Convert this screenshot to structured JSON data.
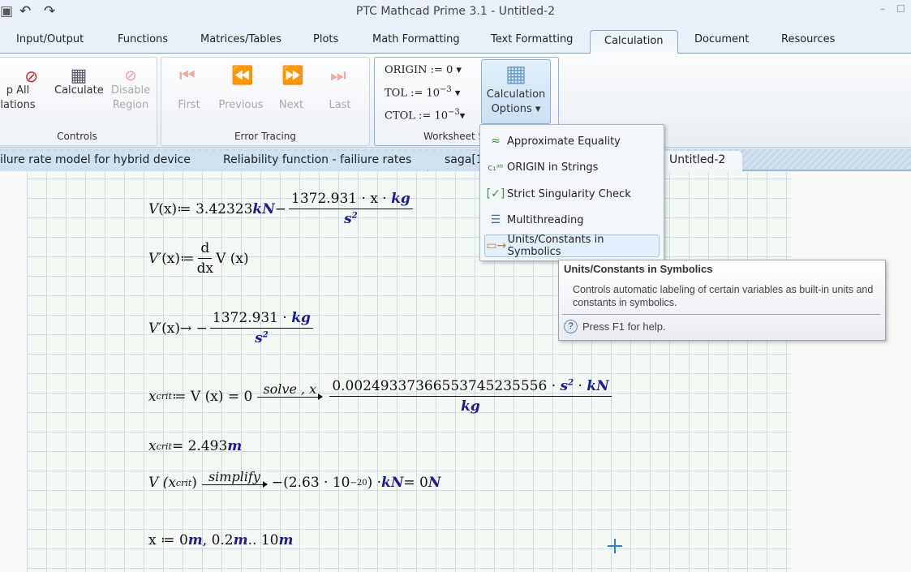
{
  "window": {
    "title": "PTC Mathcad Prime 3.1 - Untitled-2"
  },
  "menu_tabs": [
    "Input/Output",
    "Functions",
    "Matrices/Tables",
    "Plots",
    "Math Formatting",
    "Text Formatting",
    "Calculation",
    "Document",
    "Resources"
  ],
  "active_tab": "Calculation",
  "ribbon": {
    "controls": {
      "label": "Controls",
      "stop_all": [
        "p All",
        "lations"
      ],
      "calculate": "Calculate",
      "disable_region": [
        "Disable",
        "Region"
      ]
    },
    "error_tracing": {
      "label": "Error Tracing",
      "first": "First",
      "previous": "Previous",
      "next": "Next",
      "last": "Last"
    },
    "worksheet_settings": {
      "label": "Worksheet S",
      "origin": "ORIGIN := 0",
      "tol": "TOL := 10",
      "tol_exp": "−3",
      "ctol": "CTOL := 10",
      "ctol_exp": "−3"
    },
    "calc_options": [
      "Calculation",
      "Options"
    ]
  },
  "doc_tabs": [
    "ilure rate model for hybrid device",
    "Reliability function - failiure rates",
    "saga[1",
    "Untitled-2"
  ],
  "dropdown": {
    "items": [
      {
        "label": "Approximate Equality",
        "icon": "approx-icon"
      },
      {
        "label": "ORIGIN in Strings",
        "icon": "origin-strings-icon"
      },
      {
        "label": "Strict Singularity Check",
        "icon": "singularity-icon"
      },
      {
        "label": "Multithreading",
        "icon": "multithreading-icon"
      },
      {
        "label": "Units/Constants in Symbolics",
        "icon": "units-icon"
      }
    ]
  },
  "tooltip": {
    "title": "Units/Constants in Symbolics",
    "body": "Controls automatic labeling of certain variables as built-in units and constants in symbolics.",
    "help": "Press F1 for help."
  },
  "math": {
    "v_def": {
      "lhs": "V",
      "arg": "(x)",
      "assign": " ≔ 3.42323 ",
      "unit1": "kN",
      "minus": " − ",
      "num": "1372.931 · x · ",
      "num_unit": "kg",
      "den": "s",
      "den_exp": "2"
    },
    "deriv_def": {
      "lhs": "V′",
      "arg": "(x)",
      "assign": " ≔ ",
      "d_num": "d",
      "d_den": "dx",
      "rhs": "V (x)"
    },
    "deriv_eval": {
      "lhs": "V′",
      "arg": "(x)",
      "arrow": " → −",
      "num": "1372.931 · ",
      "num_unit": "kg",
      "den": "s",
      "den_exp": "2"
    },
    "solve": {
      "lhs": "x",
      "sub": "crit",
      "rest": " ≔ V (x) = 0",
      "keyword": "solve , x",
      "num": "0.00249337366553745235556 · ",
      "u1": "s",
      "u1_exp": "2",
      "dot": " · ",
      "u2": "kN",
      "den": "kg"
    },
    "xcrit_eval": {
      "lhs": "x",
      "sub": "crit",
      "rest": " = 2.493 ",
      "unit": "m"
    },
    "simplify": {
      "lhs": "V (x",
      "sub": "crit",
      "close": ")",
      "keyword": "simplify",
      "res": "−(2.63 · 10",
      "res_exp": "−20",
      "res2": ") · ",
      "u1": "kN",
      "eq": " = 0 ",
      "u2": "N"
    },
    "range": {
      "lhs": "x ≔ 0 ",
      "u1": "m",
      "mid": ", 0.2 ",
      "u2": "m",
      "dots": " .. 10 ",
      "u3": "m"
    }
  }
}
